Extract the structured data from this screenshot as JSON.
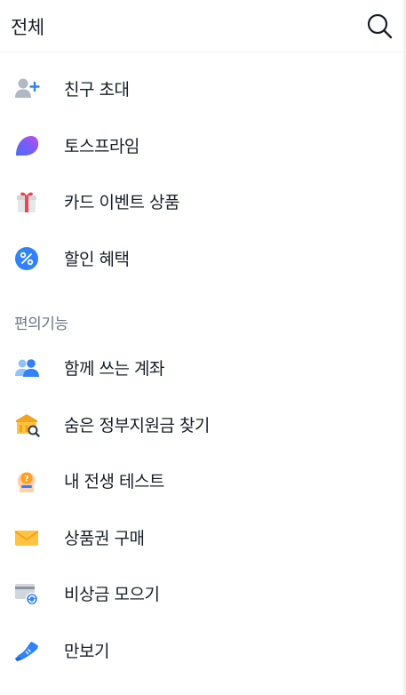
{
  "header": {
    "title": "전체",
    "search_icon": "search-icon"
  },
  "menu": [
    {
      "label": "친구 초대",
      "icon": "add-friend-icon"
    },
    {
      "label": "토스프라임",
      "icon": "toss-prime-icon"
    },
    {
      "label": "카드 이벤트 상품",
      "icon": "gift-box-icon"
    },
    {
      "label": "할인 혜택",
      "icon": "percent-badge-icon"
    }
  ],
  "convenience": {
    "title": "편의기능",
    "items": [
      {
        "label": "함께 쓰는 계좌",
        "icon": "shared-account-icon"
      },
      {
        "label": "숨은 정부지원금 찾기",
        "icon": "government-subsidy-icon"
      },
      {
        "label": "내 전생 테스트",
        "icon": "past-life-test-icon"
      },
      {
        "label": "상품권 구매",
        "icon": "gift-card-icon"
      },
      {
        "label": "비상금 모으기",
        "icon": "emergency-fund-icon"
      },
      {
        "label": "만보기",
        "icon": "pedometer-icon"
      }
    ]
  },
  "colors": {
    "text": "#191f28",
    "secondary_text": "#6b7684",
    "blue": "#3182f6"
  }
}
